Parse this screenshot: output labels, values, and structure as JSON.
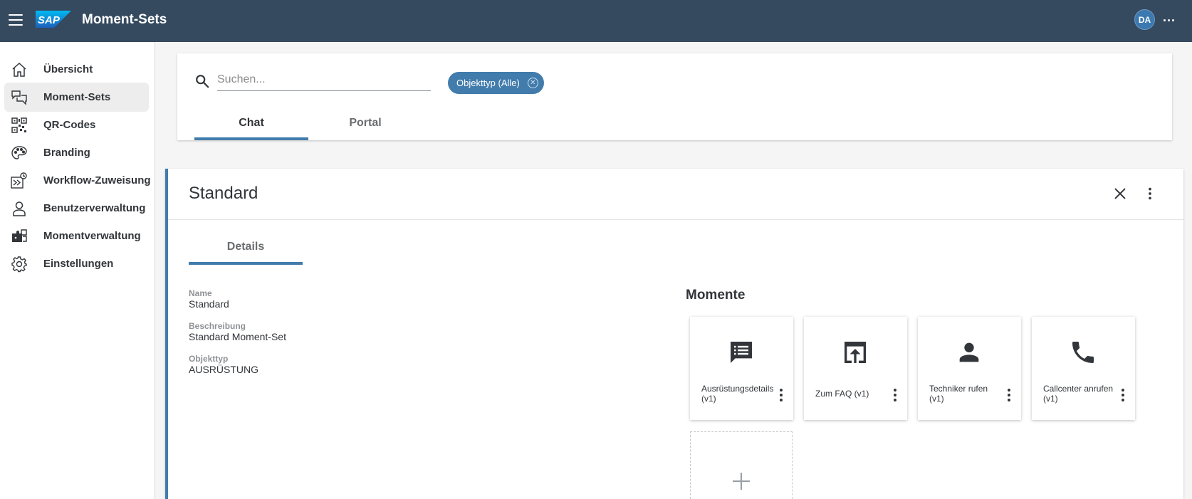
{
  "shell": {
    "title": "Moment-Sets",
    "logo": "SAP",
    "avatar_initials": "DA",
    "more_label": "...",
    "color": "#354a5f"
  },
  "sidebar": {
    "items": [
      {
        "label": "Übersicht",
        "icon": "home-icon"
      },
      {
        "label": "Moment-Sets",
        "icon": "chat-bubbles-icon",
        "active": true
      },
      {
        "label": "QR-Codes",
        "icon": "qr-code-icon"
      },
      {
        "label": "Branding",
        "icon": "palette-icon"
      },
      {
        "label": "Workflow-Zuweisung",
        "icon": "workflow-icon"
      },
      {
        "label": "Benutzerverwaltung",
        "icon": "user-icon"
      },
      {
        "label": "Momentverwaltung",
        "icon": "puzzle-icon"
      },
      {
        "label": "Einstellungen",
        "icon": "gear-icon"
      }
    ]
  },
  "search": {
    "placeholder": "Suchen...",
    "value": "",
    "filter_chip": "Objekttyp (Alle)",
    "tabs": [
      {
        "label": "Chat",
        "active": true
      },
      {
        "label": "Portal",
        "active": false
      }
    ]
  },
  "detail": {
    "title": "Standard",
    "tab": "Details",
    "fields": [
      {
        "label": "Name",
        "value": "Standard"
      },
      {
        "label": "Beschreibung",
        "value": "Standard Moment-Set"
      },
      {
        "label": "Objekttyp",
        "value": "AUSRÜSTUNG"
      }
    ],
    "momente_title": "Momente",
    "moments": [
      {
        "label": "Ausrüstungsdetails (v1)",
        "icon": "list-message-icon"
      },
      {
        "label": "Zum FAQ (v1)",
        "icon": "open-in-new-icon"
      },
      {
        "label": "Techniker rufen (v1)",
        "icon": "person-icon"
      },
      {
        "label": "Callcenter anrufen (v1)",
        "icon": "phone-icon"
      }
    ],
    "add_label": "+"
  },
  "colors": {
    "accent": "#427cac",
    "text": "#32363a"
  }
}
